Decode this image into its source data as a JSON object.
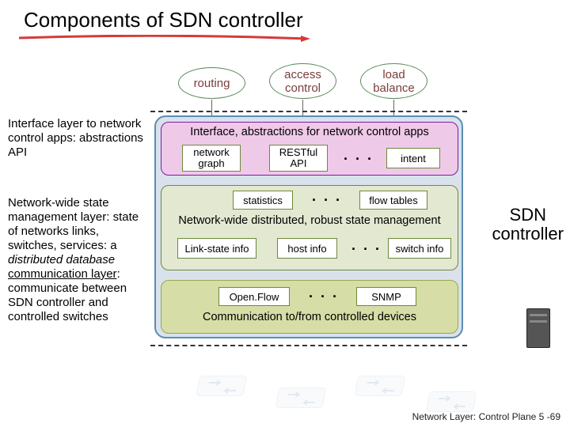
{
  "title": "Components of SDN controller",
  "top_apps": {
    "routing": "routing",
    "access": "access\ncontrol",
    "load": "load\nbalance"
  },
  "interface_layer": {
    "caption": "Interface, abstractions for network control apps",
    "boxes": {
      "graph": "network\ngraph",
      "rest": "RESTful\nAPI",
      "intent": "intent"
    },
    "desc": "Interface layer to network control apps:  abstractions API"
  },
  "state_layer": {
    "caption_top_boxes": {
      "stats": "statistics",
      "flow": "flow tables"
    },
    "caption": "Network-wide distributed, robust  state management",
    "boxes": {
      "link": "Link-state info",
      "host": "host info",
      "switch": "switch info"
    },
    "desc_html": "Network-wide state management layer: state of networks links, switches, services: a <i>distributed database</i> communication layer: communicate between SDN controller and controlled switches"
  },
  "comm_layer": {
    "boxes": {
      "openflow": "Open.Flow",
      "snmp": "SNMP"
    },
    "caption": "Communication to/from controlled devices"
  },
  "right_label": "SDN\ncontroller",
  "dots": "· · ·",
  "footer": "Network Layer: Control Plane  5 -69"
}
